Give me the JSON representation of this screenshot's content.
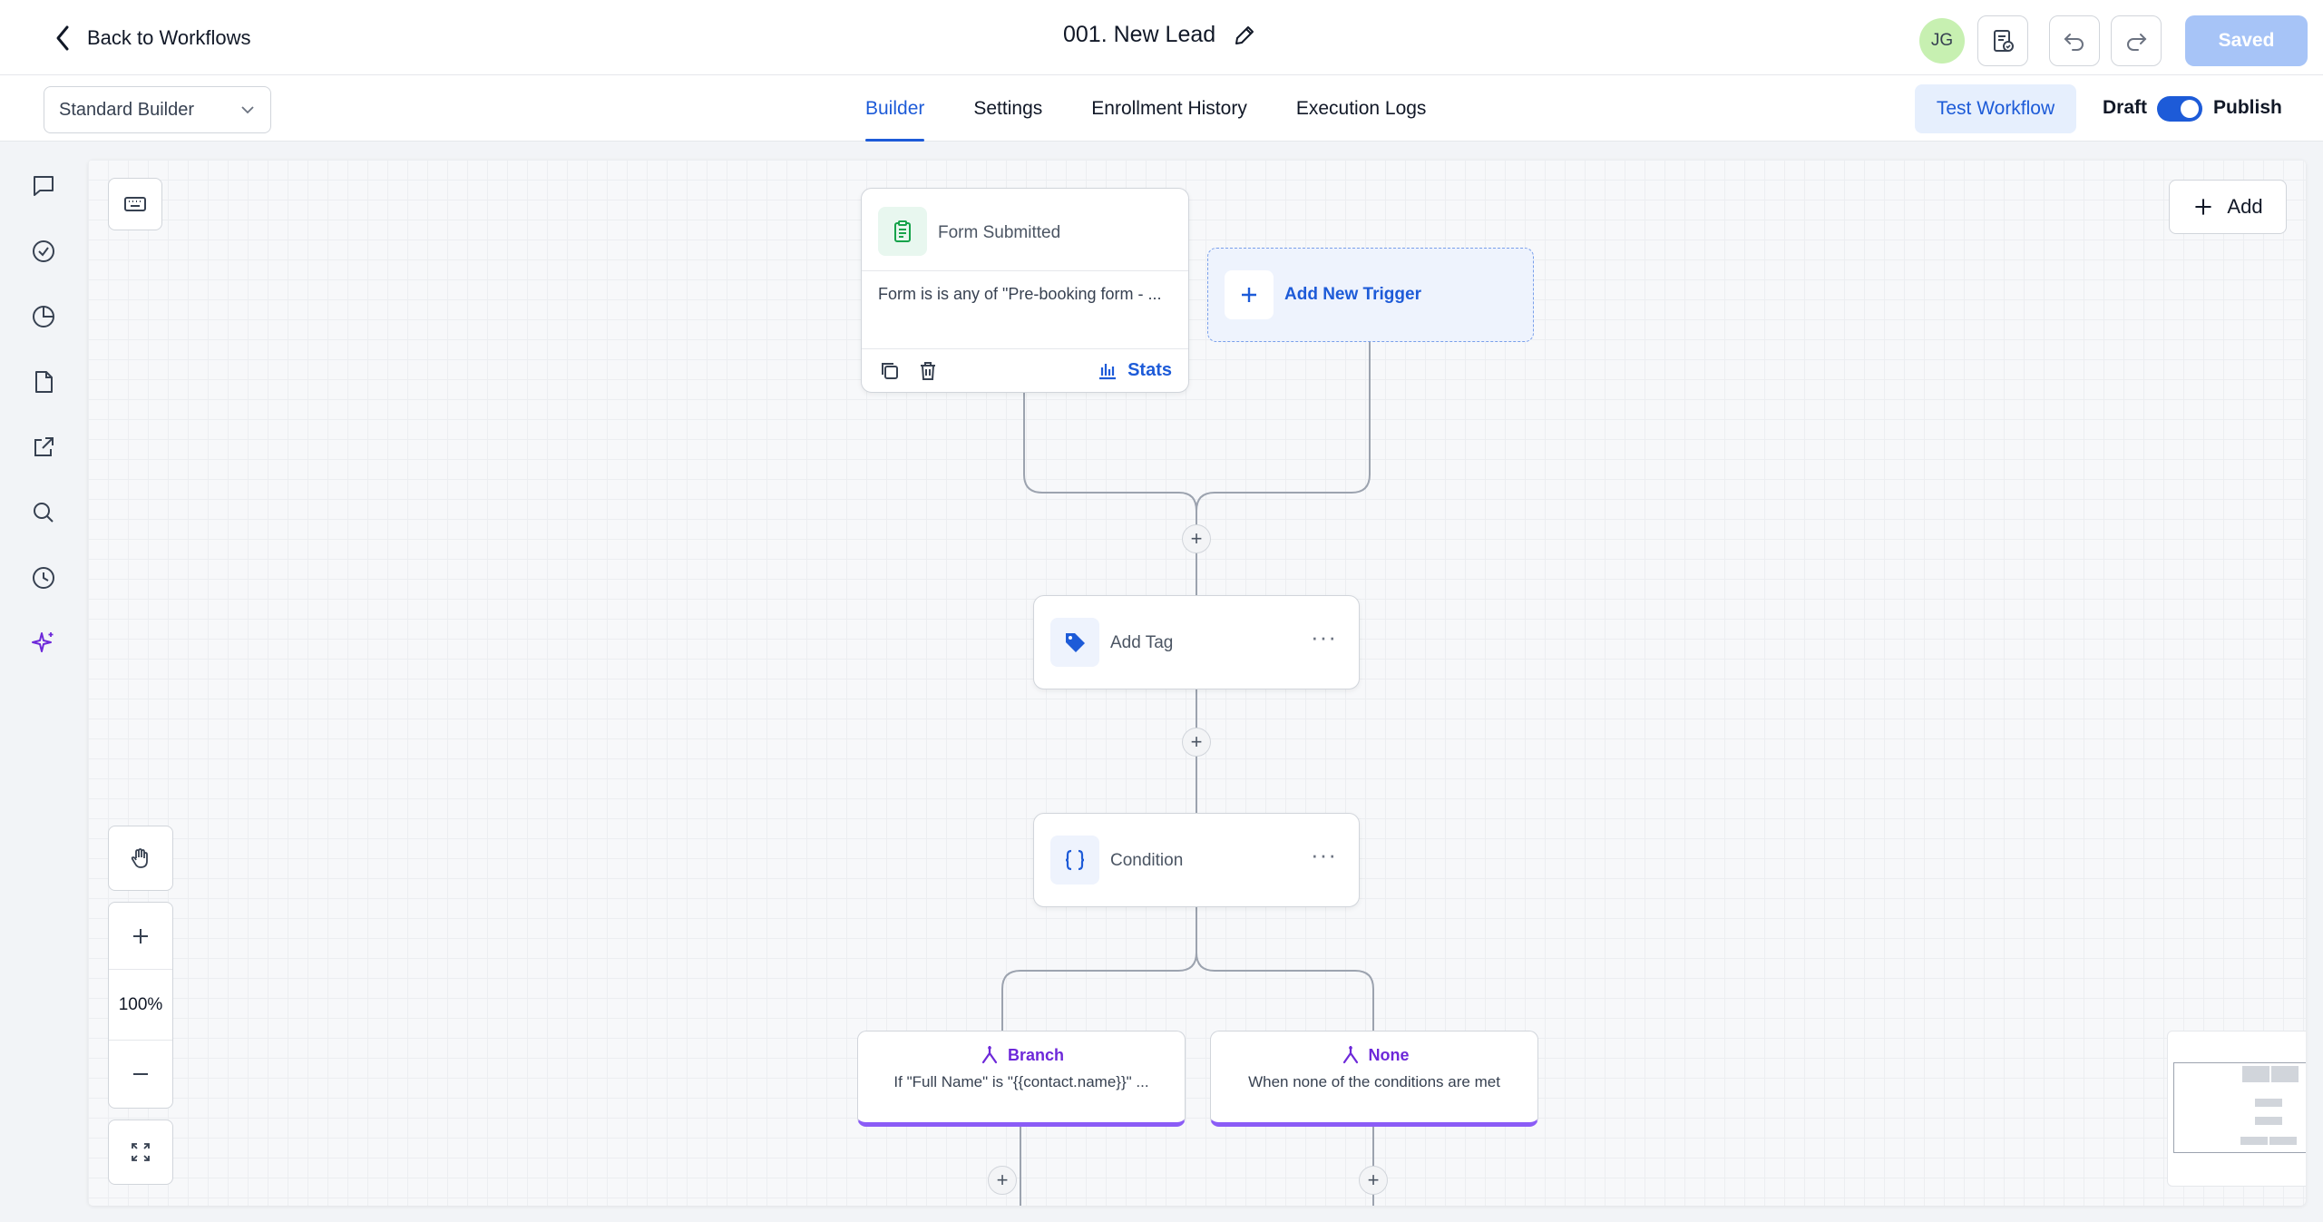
{
  "header": {
    "back_label": "Back to Workflows",
    "title": "001. New Lead",
    "avatar_initials": "JG",
    "saved_label": "Saved"
  },
  "subbar": {
    "builder_select": "Standard Builder",
    "tabs": [
      {
        "label": "Builder",
        "active": true
      },
      {
        "label": "Settings",
        "active": false
      },
      {
        "label": "Enrollment History",
        "active": false
      },
      {
        "label": "Execution Logs",
        "active": false
      }
    ],
    "test_workflow_label": "Test Workflow",
    "draft_label": "Draft",
    "publish_label": "Publish",
    "publish_toggle_on": true
  },
  "rail": {
    "icons": [
      "chat-icon",
      "check-circle-icon",
      "pie-chart-icon",
      "document-icon",
      "external-link-icon",
      "search-icon",
      "history-icon",
      "sparkle-icon"
    ]
  },
  "canvas": {
    "add_label": "Add",
    "zoom_level": "100%",
    "trigger": {
      "title": "Form Submitted",
      "description": "Form is is any of \"Pre-booking form - ...",
      "stats_label": "Stats"
    },
    "add_trigger_label": "Add New Trigger",
    "actions": [
      {
        "label": "Add Tag",
        "icon": "tag-icon"
      },
      {
        "label": "Condition",
        "icon": "braces-icon"
      }
    ],
    "branches": [
      {
        "title": "Branch",
        "description": "If \"Full Name\" is \"{{contact.name}}\" ..."
      },
      {
        "title": "None",
        "description": "When none of the conditions are met"
      }
    ]
  },
  "colors": {
    "accent": "#1d5bd8",
    "branch_purple": "#8b5cf6",
    "saved_button": "#a7c4f7",
    "avatar_bg": "#c7f0b1"
  }
}
